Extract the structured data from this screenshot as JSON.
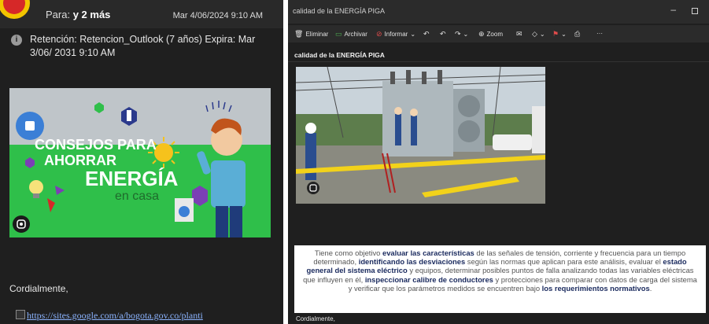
{
  "left": {
    "to_label": "Para:",
    "to_value": "y 2 más",
    "date": "Mar 4/06/2024 9:10 AM",
    "retention": "Retención: Retencion_Outlook (7 años) Expira: Mar 3/06/ 2031 9:10 AM",
    "banner": {
      "line1": "CONSEJOS PARA",
      "line2": "AHORRAR",
      "line3": "ENERGÍA",
      "line4": "en casa"
    },
    "regards": "Cordialmente,",
    "link": "https://sites.google.com/a/bogota.gov.co/planti"
  },
  "right": {
    "window_title": "calidad de la ENERGÍA PIGA",
    "toolbar": {
      "delete": "Eliminar",
      "archive": "Archivar",
      "report": "Informar",
      "zoom": "Zoom",
      "more": "···"
    },
    "subject": "calidad de la ENERGÍA PIGA",
    "body": {
      "t1": "Tiene como objetivo ",
      "b1": "evaluar las características",
      "t2": " de las señales de tensión, corriente y frecuencia para un tiempo determinado, ",
      "b2": "identificando las desviaciones",
      "t3": " según las normas que aplican para este análisis, evaluar el ",
      "b3": "estado general del sistema eléctrico",
      "t4": " y equipos, determinar posibles puntos de falla analizando todas las variables eléctricas que influyen en él, ",
      "b4": "inspeccionar calibre de conductores",
      "t5": " y protecciones para comparar con datos de carga del sistema y verificar que los parámetros medidos se encuentren bajo ",
      "b5": "los requerimientos normativos",
      "t6": "."
    },
    "regards": "Cordialmente,"
  },
  "colors": {
    "dark_bg": "#1f1f1f",
    "toolbar_bg": "#2b2b2b",
    "banner_green": "#2fbf4a",
    "banner_gray": "#bfc5c9",
    "link_blue": "#8cb4ff",
    "emphasis_navy": "#1a2a5e"
  }
}
